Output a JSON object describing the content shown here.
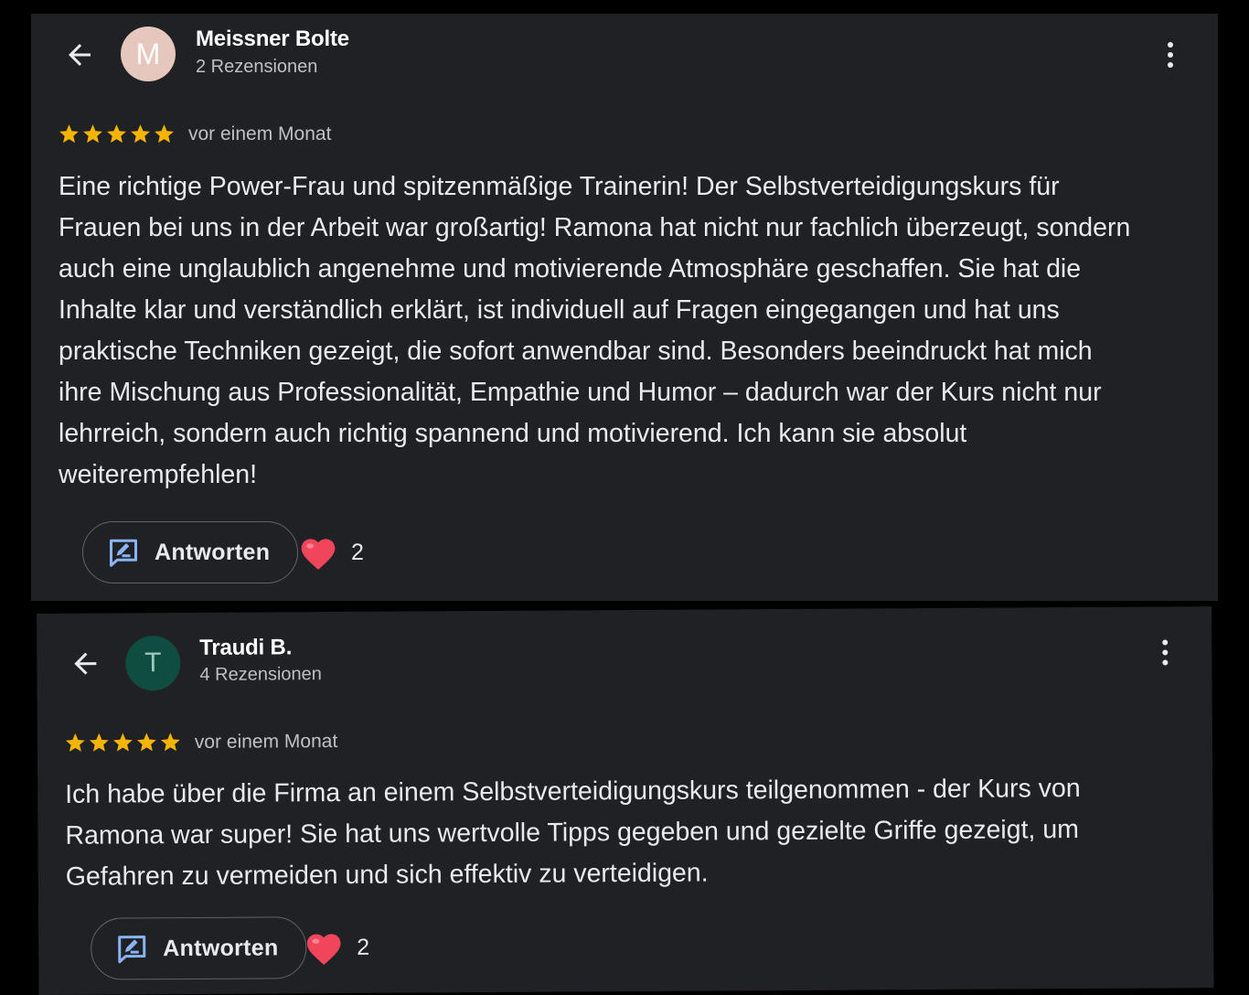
{
  "colors": {
    "card_bg": "#202124",
    "star": "#f5b400",
    "reply_icon": "#8ab4f8",
    "heart": "#f0455b",
    "avatar1_bg": "#e6c7bd",
    "avatar2_bg": "#0e4d3f"
  },
  "reviews": [
    {
      "reviewer": "Meissner Bolte",
      "avatar_letter": "M",
      "review_count": "2 Rezensionen",
      "rating": 5,
      "date": "vor einem Monat",
      "text": "Eine richtige Power-Frau und spitzenmäßige Trainerin! Der Selbstverteidigungskurs für\nFrauen bei uns in der Arbeit war großartig! Ramona hat nicht nur fachlich überzeugt, sondern\nauch eine unglaublich angenehme und motivierende Atmosphäre geschaffen. Sie hat die\nInhalte klar und verständlich erklärt, ist individuell auf Fragen eingegangen und hat uns\npraktische Techniken gezeigt, die sofort anwendbar sind. Besonders beeindruckt hat mich\nihre Mischung aus Professionalität, Empathie und Humor – dadurch war der Kurs nicht nur\nlehrreich, sondern auch richtig spannend und motivierend. Ich kann sie absolut\nweiterempfehlen!",
      "reply_label": "Antworten",
      "likes": "2"
    },
    {
      "reviewer": "Traudi B.",
      "avatar_letter": "T",
      "review_count": "4 Rezensionen",
      "rating": 5,
      "date": "vor einem Monat",
      "text": "Ich habe über die Firma an einem Selbstverteidigungskurs teilgenommen - der Kurs von\nRamona war super! Sie hat uns wertvolle Tipps gegeben und gezielte Griffe gezeigt, um\nGefahren zu vermeiden und sich effektiv zu verteidigen.",
      "reply_label": "Antworten",
      "likes": "2"
    }
  ]
}
